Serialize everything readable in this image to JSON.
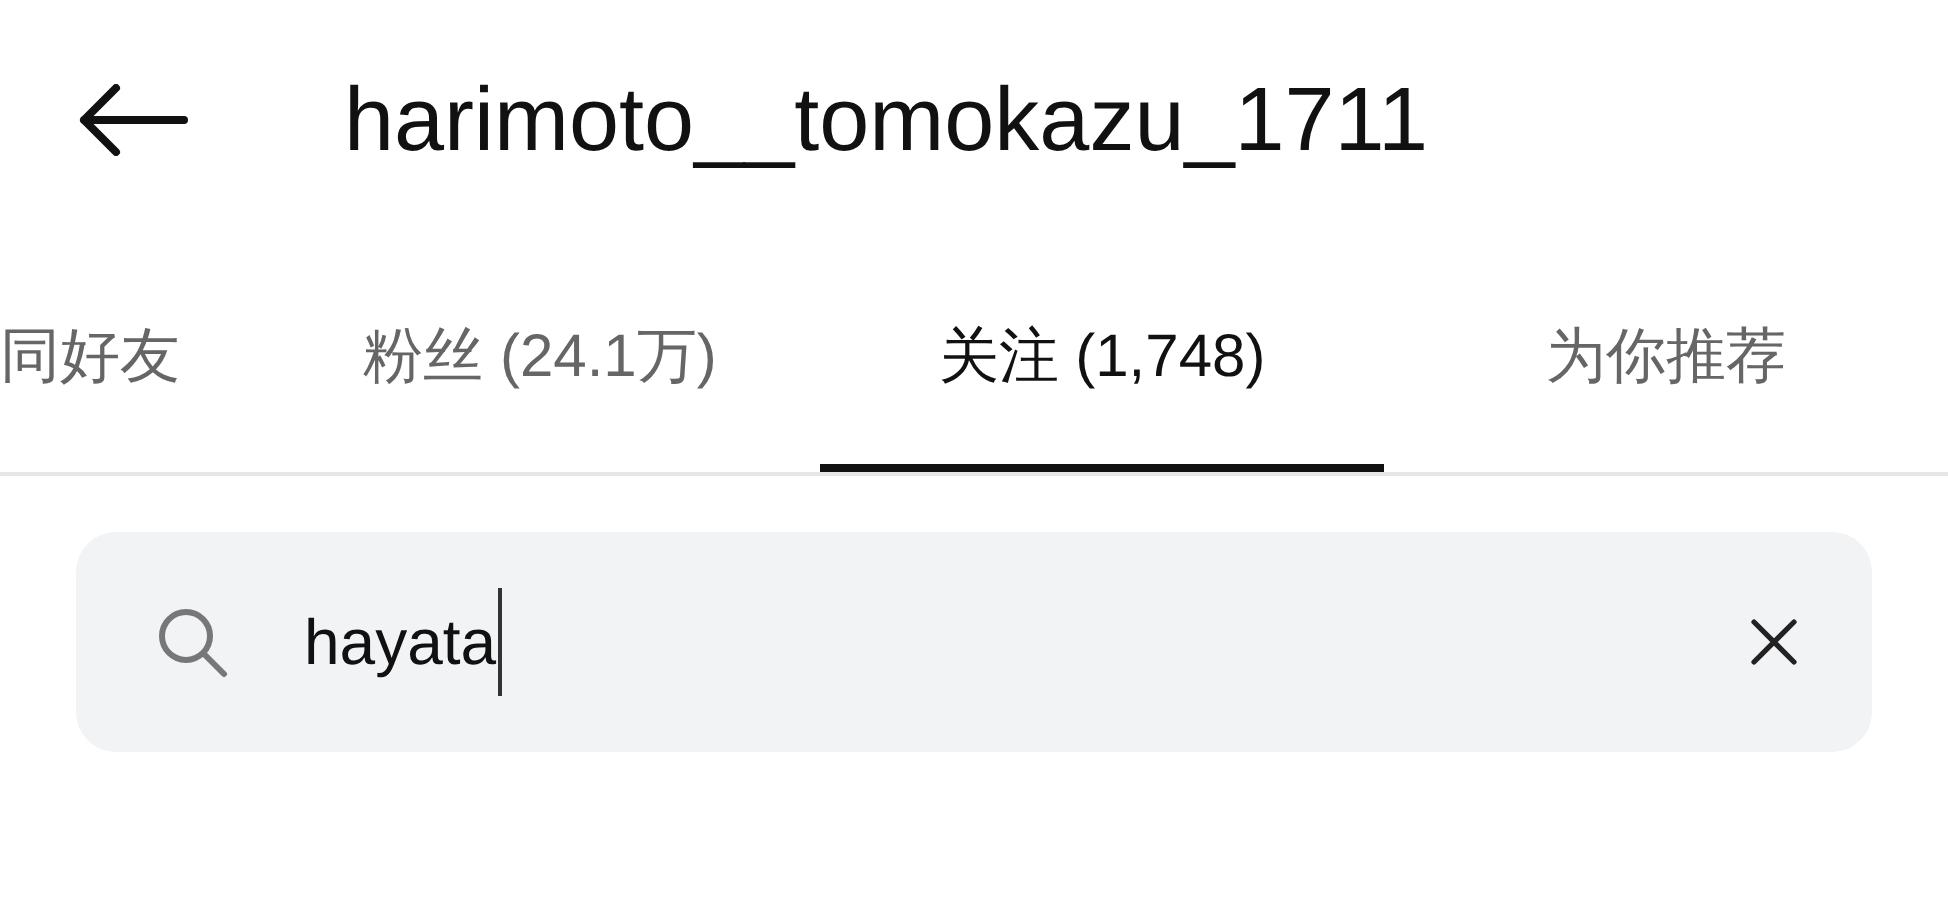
{
  "header": {
    "title": "harimoto__tomokazu_1711"
  },
  "tabs": [
    {
      "label": "同好友",
      "selected": false
    },
    {
      "label": "粉丝 (24.1万)",
      "selected": false
    },
    {
      "label": "关注 (1,748)",
      "selected": true
    },
    {
      "label": "为你推荐",
      "selected": false
    }
  ],
  "search": {
    "value": "hayata"
  }
}
